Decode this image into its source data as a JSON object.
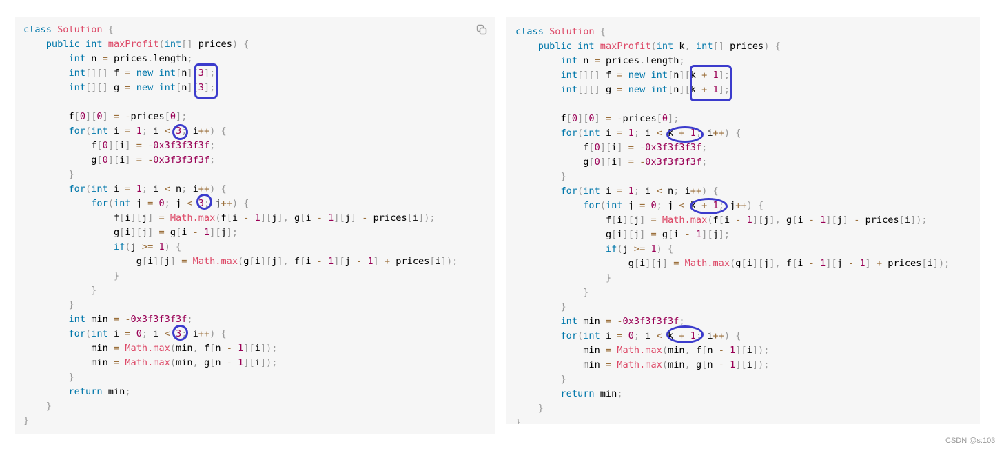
{
  "left_code": {
    "lines": [
      "class Solution {",
      "    public int maxProfit(int[] prices) {",
      "        int n = prices.length;",
      "        int[][] f = new int[n][3];",
      "        int[][] g = new int[n][3];",
      "",
      "        f[0][0] = -prices[0];",
      "        for(int i = 1; i < 3; i++) {",
      "            f[0][i] = -0x3f3f3f3f;",
      "            g[0][i] = -0x3f3f3f3f;",
      "        }",
      "        for(int i = 1; i < n; i++) {",
      "            for(int j = 0; j < 3; j++) {",
      "                f[i][j] = Math.max(f[i - 1][j], g[i - 1][j] - prices[i]);",
      "                g[i][j] = g[i - 1][j];",
      "                if(j >= 1) {",
      "                    g[i][j] = Math.max(g[i][j], f[i - 1][j - 1] + prices[i]);",
      "                }",
      "            }",
      "        }",
      "        int min = -0x3f3f3f3f;",
      "        for(int i = 0; i < 3; i++) {",
      "            min = Math.max(min, f[n - 1][i]);",
      "            min = Math.max(min, g[n - 1][i]);",
      "        }",
      "        return min;",
      "    }",
      "}"
    ],
    "copy_icon": "copy-icon"
  },
  "right_code": {
    "lines": [
      "class Solution {",
      "    public int maxProfit(int k, int[] prices) {",
      "        int n = prices.length;",
      "        int[][] f = new int[n][k + 1];",
      "        int[][] g = new int[n][k + 1];",
      "",
      "        f[0][0] = -prices[0];",
      "        for(int i = 1; i < k + 1; i++) {",
      "            f[0][i] = -0x3f3f3f3f;",
      "            g[0][i] = -0x3f3f3f3f;",
      "        }",
      "        for(int i = 1; i < n; i++) {",
      "            for(int j = 0; j < k + 1; j++) {",
      "                f[i][j] = Math.max(f[i - 1][j], g[i - 1][j] - prices[i]);",
      "                g[i][j] = g[i - 1][j];",
      "                if(j >= 1) {",
      "                    g[i][j] = Math.max(g[i][j], f[i - 1][j - 1] + prices[i]);",
      "                }",
      "            }",
      "        }",
      "        int min = -0x3f3f3f3f;",
      "        for(int i = 0; i < k + 1; i++) {",
      "            min = Math.max(min, f[n - 1][i]);",
      "            min = Math.max(min, g[n - 1][i]);",
      "        }",
      "        return min;",
      "    }",
      "}"
    ]
  },
  "colors": {
    "keyword": "#0077aa",
    "function": "#dd4a68",
    "number": "#990055",
    "operator": "#9a6e3a",
    "punctuation": "#999999",
    "highlight": "#3b3bcc",
    "background": "#f6f6f6"
  },
  "watermark": "CSDN @s:103"
}
